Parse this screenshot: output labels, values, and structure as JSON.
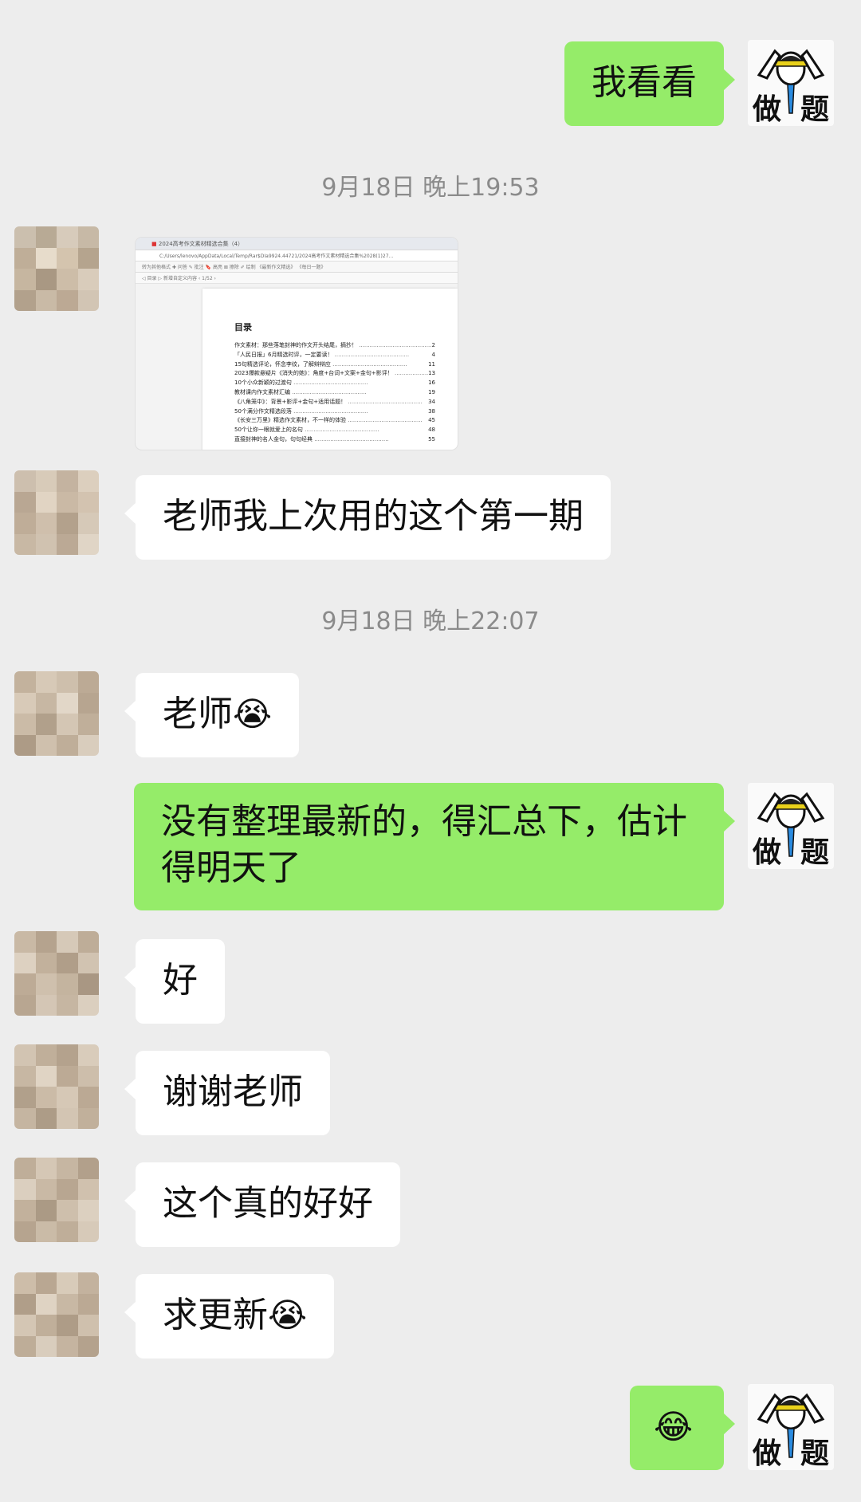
{
  "messages": [
    {
      "side": "out",
      "text": "我看看"
    },
    {
      "side": "time",
      "text": "9月18日 晚上19:53"
    },
    {
      "side": "in",
      "type": "image",
      "doc": {
        "tab_title": "2024高考作文素材精选合集（4）",
        "address": "C:/Users/lenovo/AppData/Local/Temp/Rar$DIa9924.44721/2024高考作文素材精选合集%2028(1)27...",
        "toolbar": "转为其他格式    ✚ 问答    ✎ 批注    🔖 高亮    ⊠ 擦除    ✐ 绘制    《最新作文精选》    《每日一题》",
        "toolbar2": "◁  目录  ▷        新增自定义内容        ‹ 1/52 ›",
        "heading": "目录",
        "toc": [
          {
            "text": "作文素材：那些落笔封神的作文开头结尾，摘抄！",
            "page": "2"
          },
          {
            "text": "「人民日报」6月精选时评，一定要读！",
            "page": "4"
          },
          {
            "text": "15句精选评论，怀念李纹，了解辩辩应",
            "page": "11"
          },
          {
            "text": "2023爆款悬疑片《消失的她》：角度+台词+文案+金句+影评！",
            "page": "13"
          },
          {
            "text": "10个小众新颖的过渡句",
            "page": "16"
          },
          {
            "text": "教材课内作文素材汇编",
            "page": "19"
          },
          {
            "text": "《八角笼中》：背景+影评+金句+适用话题！",
            "page": "34"
          },
          {
            "text": "50个满分作文精选段落",
            "page": "38"
          },
          {
            "text": "《长安三万里》精选作文素材，不一样的体验",
            "page": "45"
          },
          {
            "text": "50个让你一眼就爱上的名句",
            "page": "48"
          },
          {
            "text": "直接封神的名人金句，句句经典",
            "page": "55"
          }
        ]
      }
    },
    {
      "side": "in",
      "text": "老师我上次用的这个第一期"
    },
    {
      "side": "time",
      "text": "9月18日 晚上22:07"
    },
    {
      "side": "in",
      "text": "老师",
      "emoji": "😭"
    },
    {
      "side": "out",
      "text_lines": [
        "没有整理最新的，得汇总下，估计",
        "得明天了"
      ]
    },
    {
      "side": "in",
      "text": "好"
    },
    {
      "side": "in",
      "text": "谢谢老师"
    },
    {
      "side": "in",
      "text": "这个真的好好"
    },
    {
      "side": "in",
      "text": "求更新",
      "emoji": "😭"
    },
    {
      "side": "out",
      "emoji": "😂"
    }
  ],
  "my_avatar": {
    "caption_left": "做",
    "caption_right": "题"
  },
  "colors": {
    "background": "#ededed",
    "incoming": "#ffffff",
    "outgoing": "#95ec69",
    "timestamp": "#8b8b8b"
  }
}
